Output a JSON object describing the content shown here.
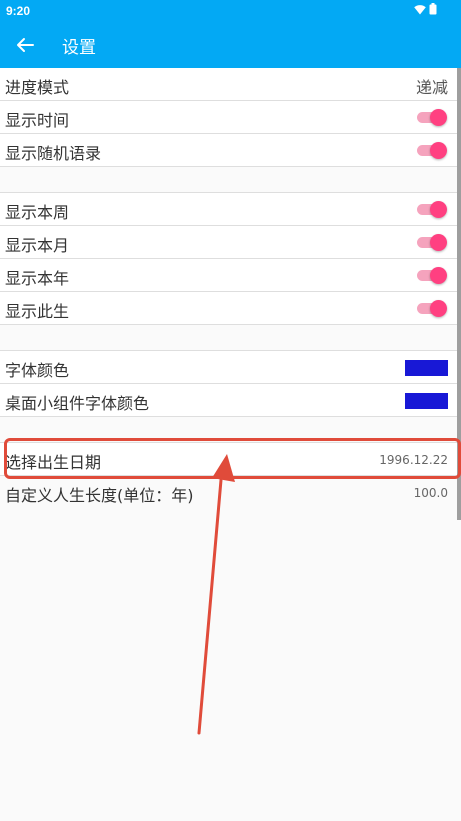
{
  "status_bar": {
    "time": "9:20"
  },
  "app_bar": {
    "title": "设置",
    "back_icon": "arrow-left-icon"
  },
  "colors": {
    "primary": "#03a9f4",
    "accent": "#ff4081",
    "swatch_font_color": "#1818d6",
    "swatch_widget_font_color": "#1818d6",
    "highlight": "#e04b3a"
  },
  "settings": {
    "progress_mode": {
      "label": "进度模式",
      "value": "递减"
    },
    "show_time": {
      "label": "显示时间",
      "on": true
    },
    "show_random_quote": {
      "label": "显示随机语录",
      "on": true
    },
    "show_week": {
      "label": "显示本周",
      "on": true
    },
    "show_month": {
      "label": "显示本月",
      "on": true
    },
    "show_year": {
      "label": "显示本年",
      "on": true
    },
    "show_life": {
      "label": "显示此生",
      "on": true
    },
    "font_color": {
      "label": "字体颜色"
    },
    "widget_font_color": {
      "label": "桌面小组件字体颜色"
    },
    "birth_date": {
      "label": "选择出生日期",
      "value": "1996.12.22"
    },
    "life_length": {
      "label": "自定义人生长度(单位：年)",
      "value": "100.0"
    }
  }
}
